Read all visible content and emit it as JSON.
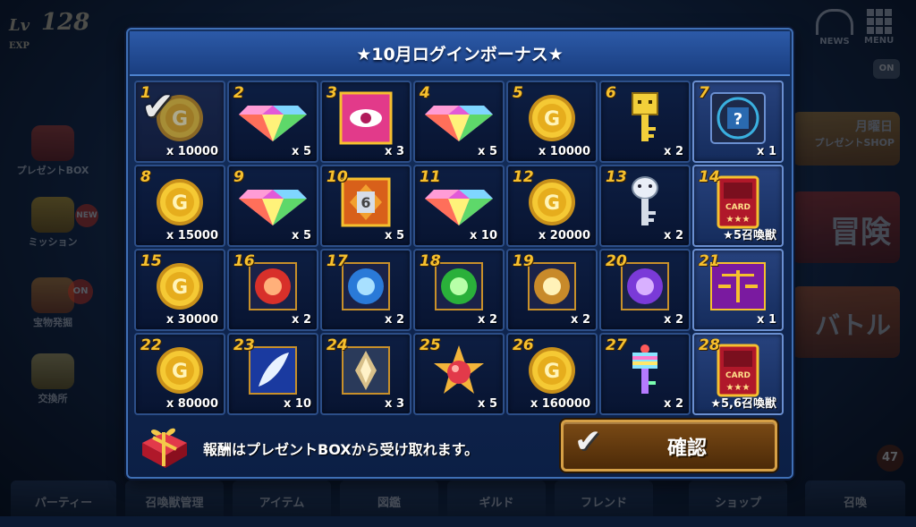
{
  "hud": {
    "level_label": "Lv",
    "level": "128",
    "exp_label": "EXP",
    "top_right": [
      "NEWS",
      "MENU"
    ],
    "side_menu": [
      "プレゼントBOX",
      "ミッション",
      "宝物発掘",
      "交換所"
    ],
    "right_menu": [
      "月曜日",
      "プレゼントSHOP",
      "冒険",
      "バトル"
    ],
    "bottom_tabs": [
      "パーティー",
      "召喚獣管理",
      "アイテム",
      "図鑑",
      "ギルド",
      "フレンド",
      "ショップ",
      "召喚"
    ],
    "badges": {
      "new": "NEW",
      "on": "ON",
      "on_right": "ON",
      "count": "47"
    }
  },
  "dialog": {
    "title": "★10月ログインボーナス★",
    "note": "報酬はプレゼントBOXから受け取れます。",
    "confirm_label": "確認"
  },
  "rewards": [
    {
      "day": "1",
      "type": "coin",
      "qty": "x 10000",
      "claimed": true
    },
    {
      "day": "2",
      "type": "gem",
      "qty": "x 5"
    },
    {
      "day": "3",
      "type": "eye",
      "qty": "x 3"
    },
    {
      "day": "4",
      "type": "gem",
      "qty": "x 5"
    },
    {
      "day": "5",
      "type": "coin",
      "qty": "x 10000"
    },
    {
      "day": "6",
      "type": "key-gold",
      "qty": "x 2"
    },
    {
      "day": "7",
      "type": "mystery",
      "qty": "x 1",
      "special": true
    },
    {
      "day": "8",
      "type": "coin",
      "qty": "x 15000"
    },
    {
      "day": "9",
      "type": "gem",
      "qty": "x 5"
    },
    {
      "day": "10",
      "type": "badge6",
      "qty": "x 5"
    },
    {
      "day": "11",
      "type": "gem",
      "qty": "x 10"
    },
    {
      "day": "12",
      "type": "coin",
      "qty": "x 20000"
    },
    {
      "day": "13",
      "type": "key-silver",
      "qty": "x 2"
    },
    {
      "day": "14",
      "type": "card",
      "qty": "★5召喚獣",
      "special": true
    },
    {
      "day": "15",
      "type": "coin",
      "qty": "x 30000"
    },
    {
      "day": "16",
      "type": "orb-fire",
      "qty": "x 2"
    },
    {
      "day": "17",
      "type": "orb-water",
      "qty": "x 2"
    },
    {
      "day": "18",
      "type": "orb-wind",
      "qty": "x 2"
    },
    {
      "day": "19",
      "type": "orb-light",
      "qty": "x 2"
    },
    {
      "day": "20",
      "type": "orb-dark",
      "qty": "x 2"
    },
    {
      "day": "21",
      "type": "scale",
      "qty": "x 1",
      "special": true
    },
    {
      "day": "22",
      "type": "coin",
      "qty": "x 80000"
    },
    {
      "day": "23",
      "type": "feather",
      "qty": "x 10"
    },
    {
      "day": "24",
      "type": "crystal",
      "qty": "x 3"
    },
    {
      "day": "25",
      "type": "star-orb",
      "qty": "x 5"
    },
    {
      "day": "26",
      "type": "coin",
      "qty": "x 160000"
    },
    {
      "day": "27",
      "type": "key-rainbow",
      "qty": "x 2"
    },
    {
      "day": "28",
      "type": "card",
      "qty": "★5,6召喚獣",
      "special": true
    }
  ],
  "colors": {
    "accent_gold": "#f6c02e",
    "title_blue": "#2c5aa8",
    "confirm_brown": "#7a4a15"
  }
}
